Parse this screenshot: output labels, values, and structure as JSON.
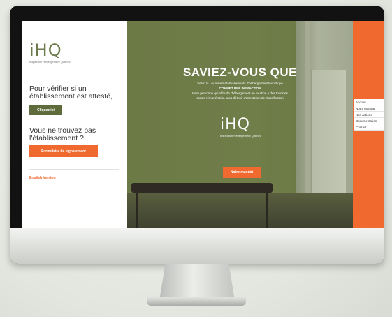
{
  "left_panel": {
    "logo": {
      "mark_i": "i",
      "mark_hq": "HQ",
      "caption": "Inspection Hébergement Québec"
    },
    "verify_text": "Pour vérifier si un établissement est attesté,",
    "verify_button": "Cliquez ici",
    "not_found_text": "Vous ne trouvez pas l'établissement ?",
    "report_button": "Formulaire de signalement",
    "english_link": "English Version"
  },
  "hero": {
    "title": "SAVIEZ-VOUS QUE",
    "lines": [
      "Selon la Loi sur les établissements d'hébergement touristique",
      "COMMET UNE INFRACTION",
      "toute personne qui offre de l'hébergement en location à des touristes",
      "contre rémunération sans détenir d'attestation de classification"
    ],
    "logo": {
      "mark_i": "i",
      "mark_hq": "HQ",
      "caption": "Inspection Hébergement Québec"
    },
    "button": "Notre mandat"
  },
  "menu": {
    "items": [
      "Accueil",
      "Notre mandat",
      "Nos actions",
      "Documentation",
      "Contact"
    ]
  },
  "colors": {
    "accent_orange": "#f06a2f",
    "olive_green": "#5f6b3a",
    "hero_green": "#7d8a55"
  }
}
